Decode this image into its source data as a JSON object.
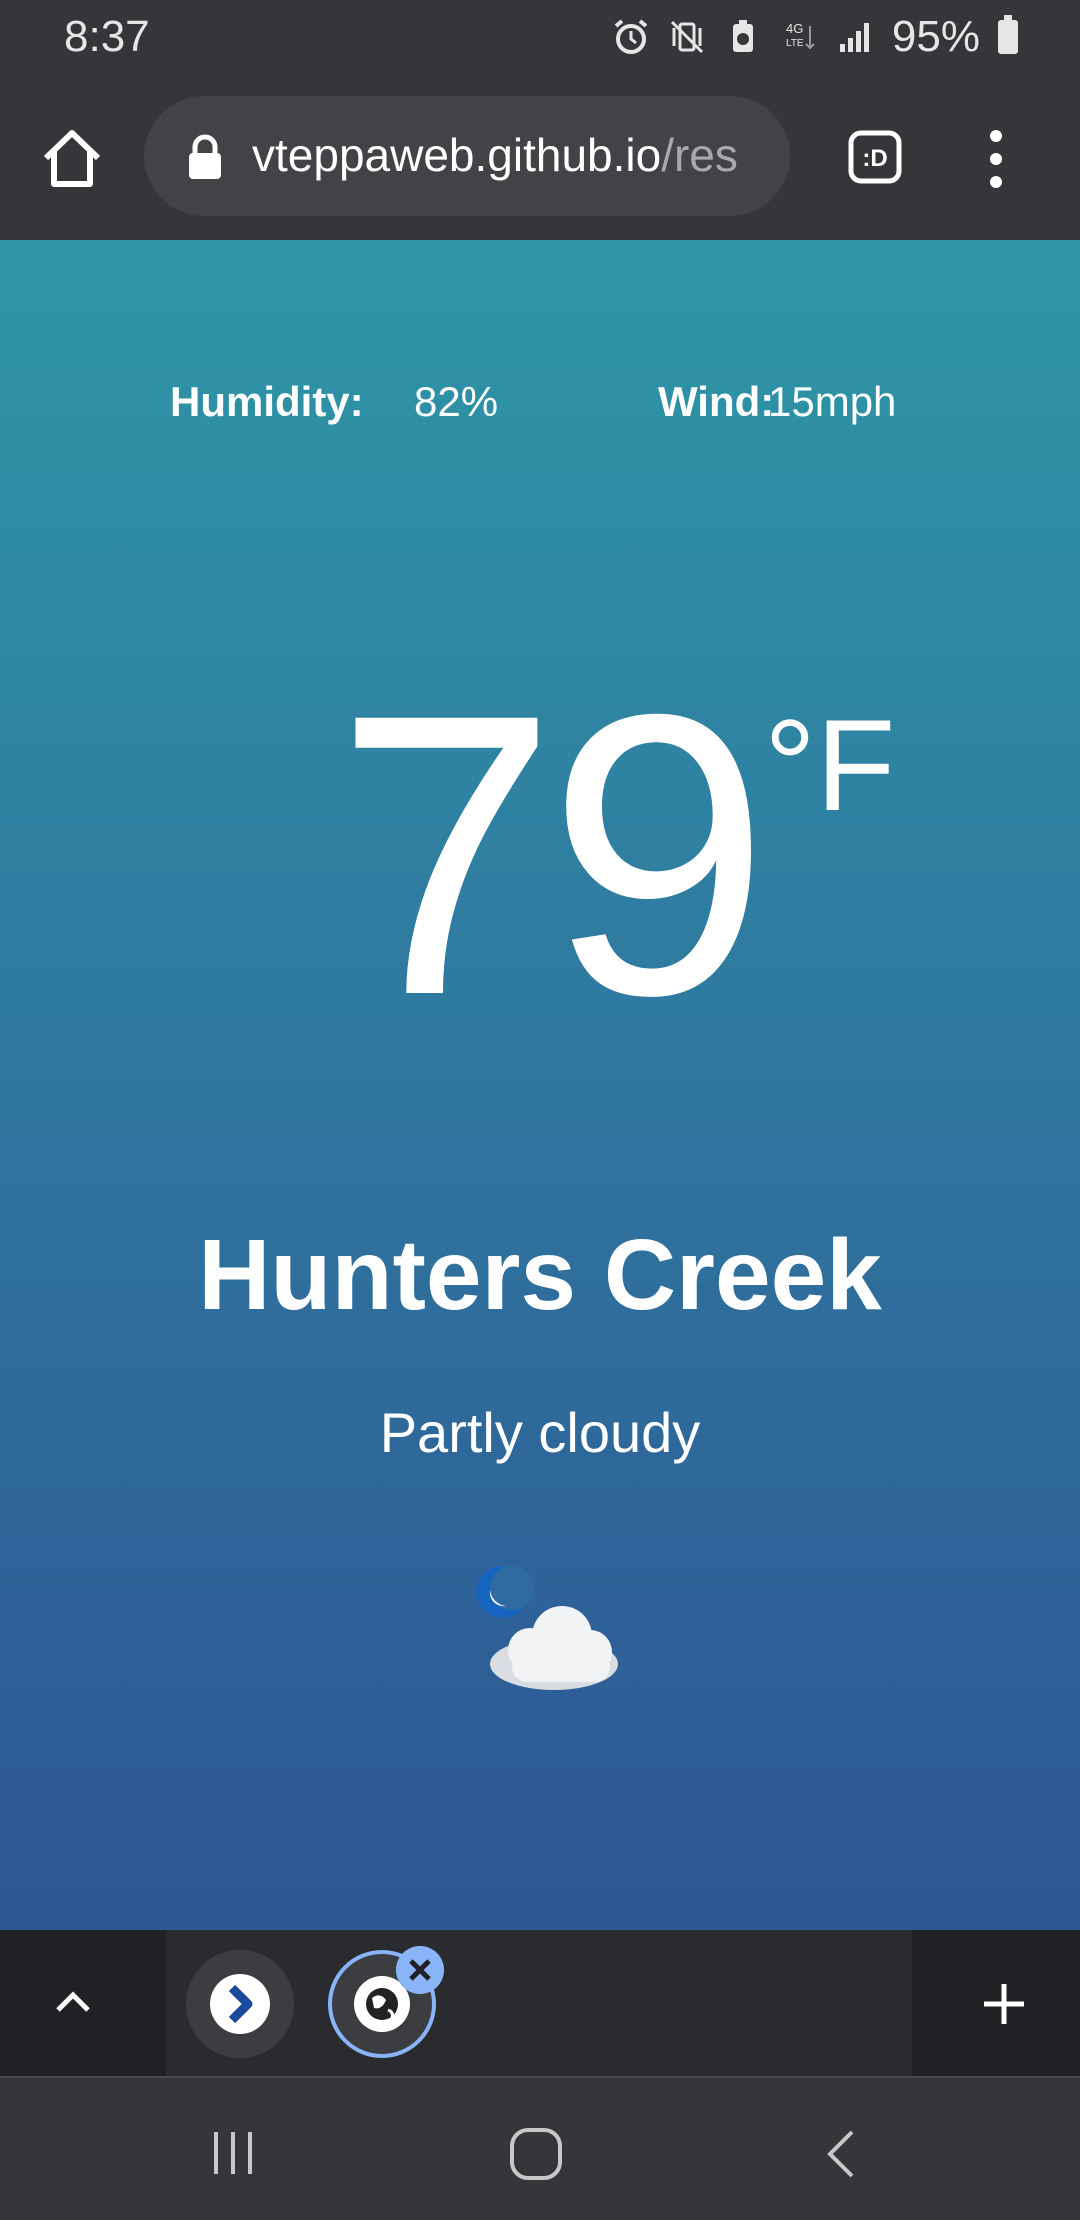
{
  "status_bar": {
    "time": "8:37",
    "battery_percent": "95%",
    "icons": [
      "alarm-icon",
      "vibrate-off-icon",
      "battery-saver-icon",
      "4g-lte-icon",
      "signal-icon",
      "battery-icon"
    ]
  },
  "browser": {
    "url_host": "vteppaweb.github.io",
    "url_path": "/res",
    "reader_label": ":D"
  },
  "weather": {
    "humidity_label": "Humidity:",
    "humidity_value": "82%",
    "wind_label": "Wind:",
    "wind_value": "15mph",
    "temperature": "79",
    "temperature_unit": "°F",
    "city": "Hunters Creek",
    "condition": "Partly cloudy",
    "condition_icon": "moon-cloud-icon"
  },
  "tabs": {
    "count_visible": 2
  },
  "colors": {
    "gradient_top": "#2e96a6",
    "gradient_bottom": "#2e5594",
    "chrome_dark": "#353639",
    "tab_accent": "#8ab4f8"
  }
}
